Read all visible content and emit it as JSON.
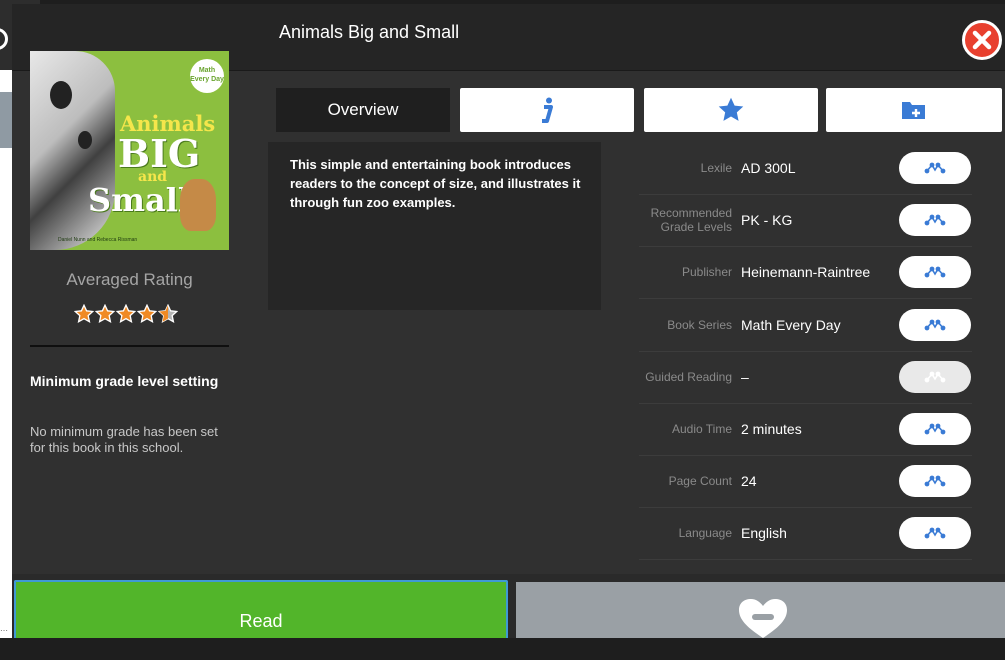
{
  "window": {
    "title": "Animals Big and Small"
  },
  "cover": {
    "badge": "Math Every Day",
    "title_line1": "Animals",
    "title_line2": "BIG",
    "title_line3": "and",
    "title_line4": "Small",
    "authors": "Daniel Nunn and Rebecca Rissman"
  },
  "rating": {
    "label": "Averaged Rating",
    "value": 4.5,
    "max": 5
  },
  "min_grade": {
    "heading": "Minimum grade level setting",
    "text": "No minimum grade has been set for this book in this school."
  },
  "tabs": {
    "overview": "Overview",
    "info_icon": "info-icon",
    "favorite_icon": "star-icon",
    "add_folder_icon": "folder-add-icon"
  },
  "description": "This simple and entertaining book introduces readers to the concept of size, and illustrates it through fun zoo examples.",
  "details": [
    {
      "label": "Lexile",
      "value": "AD 300L",
      "enabled": true
    },
    {
      "label": "Recommended Grade Levels",
      "value": "PK - KG",
      "enabled": true
    },
    {
      "label": "Publisher",
      "value": "Heinemann-Raintree",
      "enabled": true
    },
    {
      "label": "Book Series",
      "value": "Math Every Day",
      "enabled": true
    },
    {
      "label": "Guided Reading",
      "value": "–",
      "enabled": false
    },
    {
      "label": "Audio Time",
      "value": "2 minutes",
      "enabled": true
    },
    {
      "label": "Page Count",
      "value": "24",
      "enabled": true
    },
    {
      "label": "Language",
      "value": "English",
      "enabled": true
    }
  ],
  "actions": {
    "read": "Read",
    "favorite_icon": "heart-minus-icon"
  },
  "colors": {
    "accent_blue": "#3a7bd5",
    "read_green": "#52b52a",
    "close_red": "#e8402f",
    "star_orange": "#f08a24"
  }
}
